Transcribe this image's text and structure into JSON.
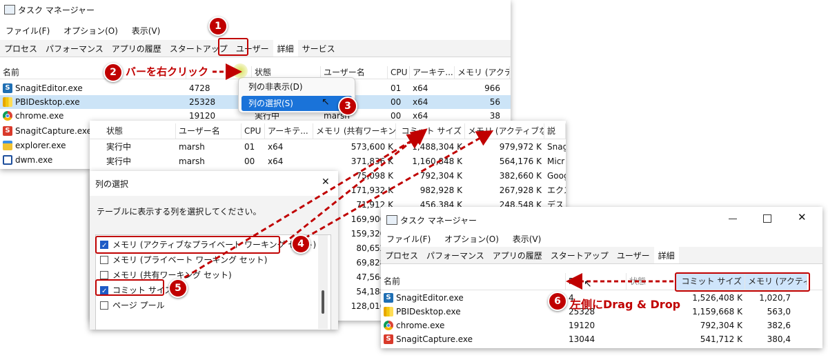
{
  "window1": {
    "title": "タスク マネージャー",
    "menu": [
      "ファイル(F)",
      "オプション(O)",
      "表示(V)"
    ],
    "tabs": [
      "プロセス",
      "パフォーマンス",
      "アプリの履歴",
      "スタートアップ",
      "ユーザー",
      "詳細",
      "サービス"
    ],
    "columns": [
      "名前",
      "",
      "状態",
      "ユーザー名",
      "CPU",
      "アーキテ...",
      "メモリ (アクティ"
    ],
    "rows": [
      {
        "name": "SnagitEditor.exe",
        "pid": "4728",
        "cpu": "01",
        "arch": "x64",
        "mem": "966"
      },
      {
        "name": "PBIDesktop.exe",
        "pid": "25328",
        "cpu": "00",
        "arch": "x64",
        "mem": "56"
      },
      {
        "name": "chrome.exe",
        "pid": "19120",
        "state": "実行中",
        "user": "marsh",
        "cpu": "00",
        "arch": "x64",
        "mem": "38"
      },
      {
        "name": "SnagitCapture.exe"
      },
      {
        "name": "explorer.exe"
      },
      {
        "name": "dwm.exe"
      }
    ]
  },
  "context_menu": {
    "items": [
      "列の非表示(D)",
      "列の選択(S)"
    ]
  },
  "window2": {
    "columns": [
      "状態",
      "ユーザー名",
      "CPU",
      "アーキテ...",
      "メモリ (共有ワーキン...",
      "コミット サイズ",
      "メモリ (アクティブな...",
      "説"
    ],
    "rows": [
      {
        "state": "実行中",
        "user": "marsh",
        "cpu": "01",
        "arch": "x64",
        "shared": "573,600 K",
        "commit": "1,488,304 K",
        "mem": "979,972 K",
        "desc": "Snag"
      },
      {
        "state": "実行中",
        "user": "marsh",
        "cpu": "00",
        "arch": "x64",
        "shared": "371,836 K",
        "commit": "1,160,848 K",
        "mem": "564,176 K",
        "desc": "Micr"
      },
      {
        "state": "",
        "user": "",
        "cpu": "",
        "arch": "",
        "shared": "75,098 K",
        "commit": "792,304 K",
        "mem": "382,660 K",
        "desc": "Goog"
      },
      {
        "state": "",
        "user": "",
        "cpu": "",
        "arch": "",
        "shared": "171,932 K",
        "commit": "982,928 K",
        "mem": "267,928 K",
        "desc": "エクス"
      },
      {
        "state": "",
        "user": "",
        "cpu": "",
        "arch": "",
        "shared": "71,912 K",
        "commit": "456,384 K",
        "mem": "248,548 K",
        "desc": "デス"
      },
      {
        "shared": "169,900 K"
      },
      {
        "shared": "159,320 K"
      },
      {
        "shared": "80,652 K"
      },
      {
        "shared": "69,828 K"
      },
      {
        "shared": "47,564 K"
      },
      {
        "shared": "54,188 K"
      },
      {
        "shared": "128,016 K"
      }
    ]
  },
  "dialog": {
    "title": "列の選択",
    "close": "✕",
    "instruction": "テーブルに表示する列を選択してください。",
    "options": [
      {
        "label": "メモリ (アクティブなプライベート ワーキング セット)",
        "checked": true
      },
      {
        "label": "メモリ (プライベート ワーキング セット)",
        "checked": false
      },
      {
        "label": "メモリ (共有ワーキング セット)",
        "checked": false
      },
      {
        "label": "コミット サイズ",
        "checked": true
      },
      {
        "label": "ページ プール",
        "checked": false
      }
    ]
  },
  "window3": {
    "title": "タスク マネージャー",
    "menu": [
      "ファイル(F)",
      "オプション(O)",
      "表示(V)"
    ],
    "tabs": [
      "プロセス",
      "パフォーマンス",
      "アプリの履歴",
      "スタートアップ",
      "ユーザー",
      "詳細"
    ],
    "columns": [
      "名前",
      "PID",
      "状態",
      "コミット サイズ",
      "メモリ (アクティブ"
    ],
    "rows": [
      {
        "name": "SnagitEditor.exe",
        "pid": "4",
        "commit": "1,526,408 K",
        "mem": "1,020,7"
      },
      {
        "name": "PBIDesktop.exe",
        "pid": "25328",
        "commit": "1,159,668 K",
        "mem": "563,0"
      },
      {
        "name": "chrome.exe",
        "pid": "19120",
        "commit": "792,304 K",
        "mem": "382,6"
      },
      {
        "name": "SnagitCapture.exe",
        "pid": "13044",
        "commit": "541,712 K",
        "mem": "380,4"
      }
    ]
  },
  "annotations": {
    "step1": "1",
    "step2": "2",
    "step3": "3",
    "step4": "4",
    "step5": "5",
    "step6": "6",
    "right_click": "バーを右クリック",
    "drag_drop": "左側にDrag & Drop"
  },
  "colors": {
    "accent_red": "#c00000",
    "selection_blue": "#1a73d9",
    "header_highlight": "#cfe5fb"
  }
}
